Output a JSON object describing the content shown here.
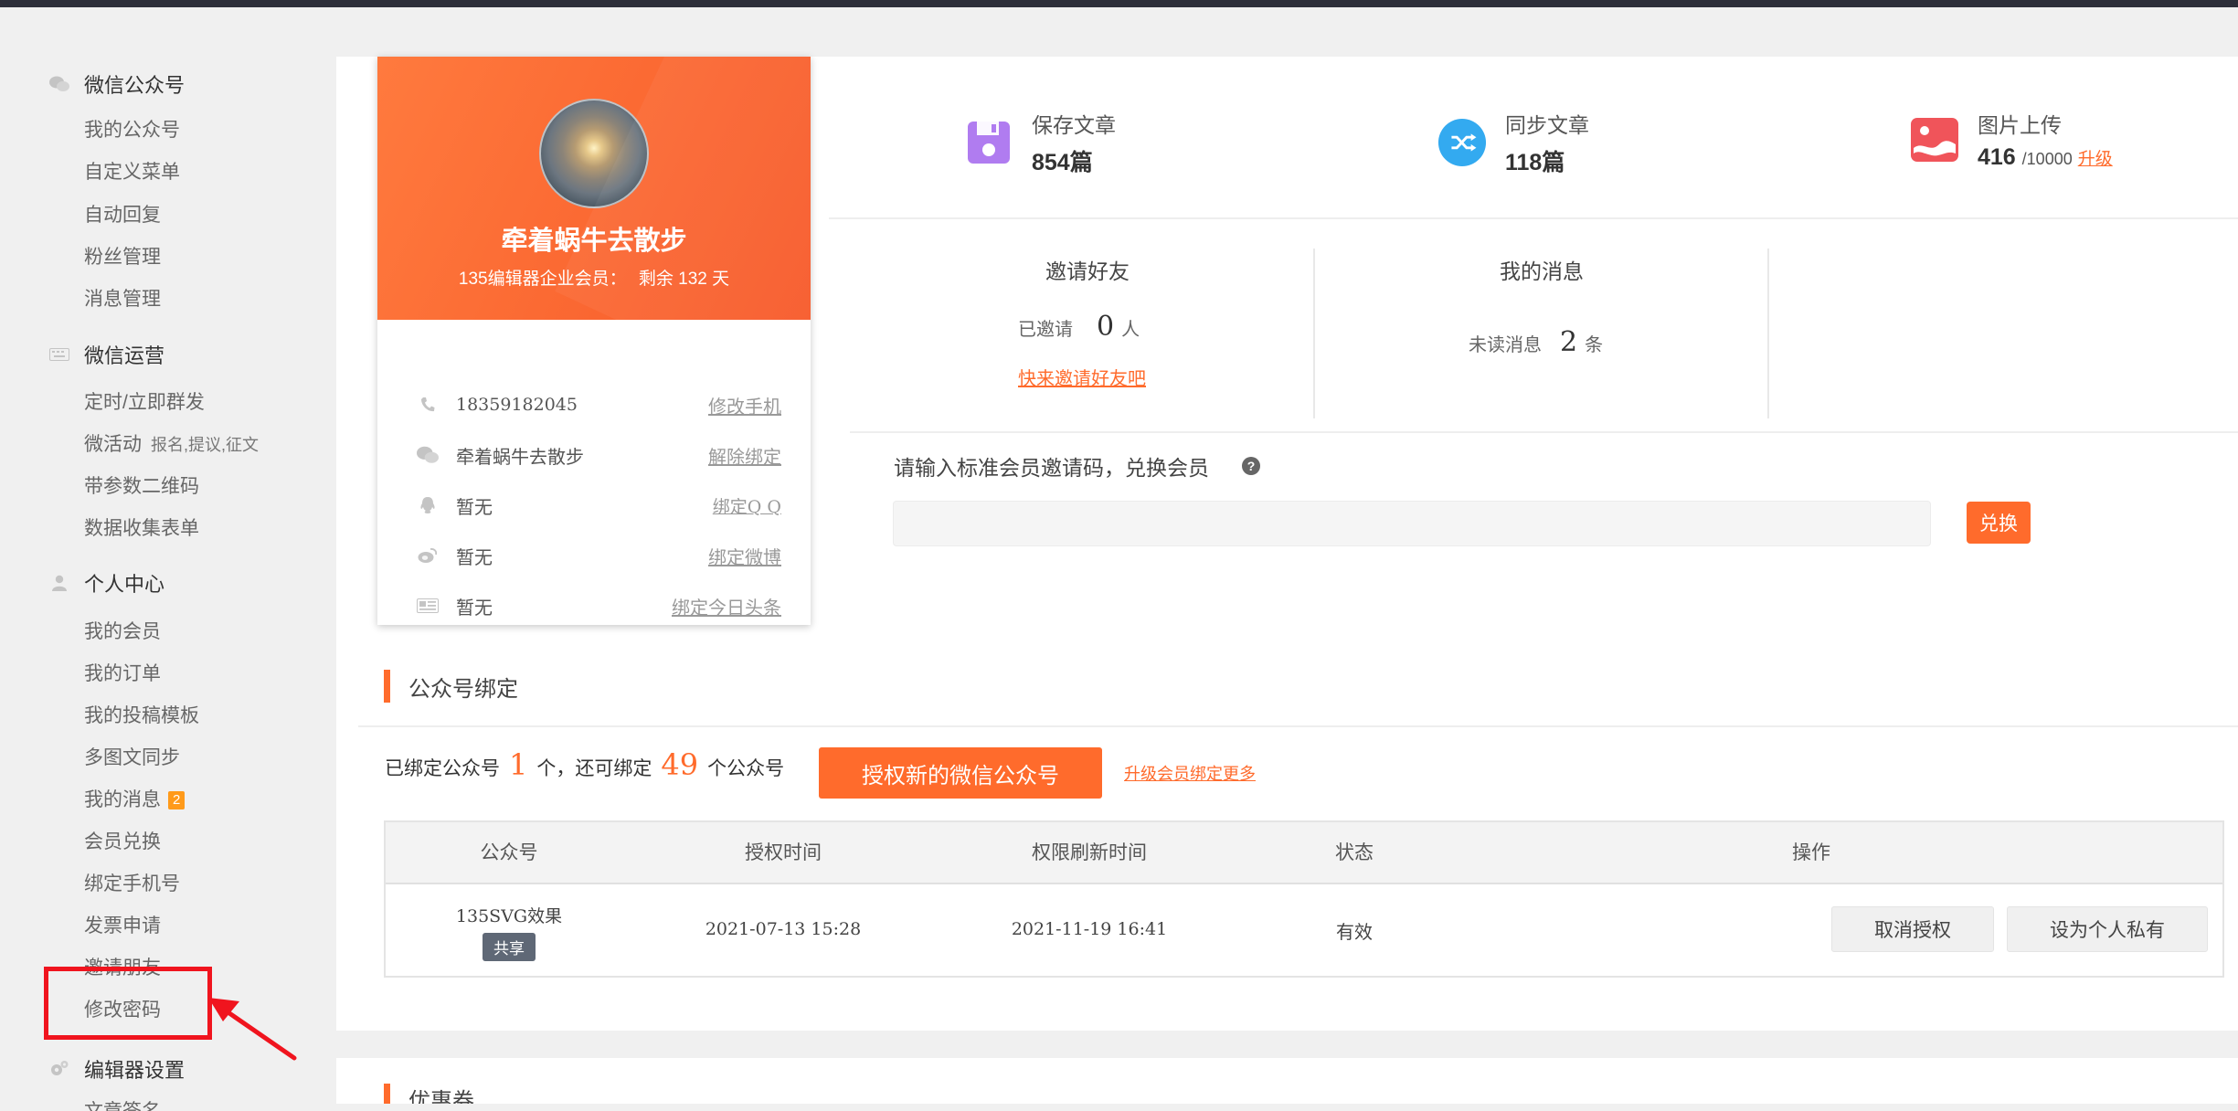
{
  "sidebar": {
    "sections": [
      {
        "icon": "wechat-icon",
        "label": "微信公众号",
        "items": [
          "我的公众号",
          "自定义菜单",
          "自动回复",
          "粉丝管理",
          "消息管理"
        ]
      },
      {
        "icon": "keyboard-icon",
        "label": "微信运营",
        "items": [
          "定时/立即群发",
          "微活动",
          "带参数二维码",
          "数据收集表单"
        ],
        "micro_note": "报名,提议,征文"
      },
      {
        "icon": "user-icon",
        "label": "个人中心",
        "items": [
          "我的会员",
          "我的订单",
          "我的投稿模板",
          "多图文同步",
          "我的消息",
          "会员兑换",
          "绑定手机号",
          "发票申请",
          "邀请朋友",
          "修改密码"
        ],
        "message_badge": "2"
      },
      {
        "icon": "gears-icon",
        "label": "编辑器设置",
        "items": [
          "文章签名"
        ]
      }
    ],
    "highlighted_item": "修改密码"
  },
  "profile": {
    "name": "牵着蜗牛去散步",
    "membership_prefix": "135编辑器企业会员：",
    "membership_days": "剩余 132 天",
    "rows": [
      {
        "icon": "phone-icon",
        "value": "18359182045",
        "action": "修改手机"
      },
      {
        "icon": "wechat-icon",
        "value": "牵着蜗牛去散步",
        "action": "解除绑定"
      },
      {
        "icon": "qq-icon",
        "value": "暂无",
        "action": "绑定Q Q"
      },
      {
        "icon": "weibo-icon",
        "value": "暂无",
        "action": "绑定微博"
      },
      {
        "icon": "toutiao-icon",
        "value": "暂无",
        "action": "绑定今日头条"
      }
    ]
  },
  "stats": {
    "saved": {
      "label": "保存文章",
      "value": "854篇",
      "color": "#b07cf0"
    },
    "synced": {
      "label": "同步文章",
      "value": "118篇",
      "color": "#33aaf0"
    },
    "images": {
      "label": "图片上传",
      "value": "416",
      "limit": "/10000",
      "upgrade": "升级",
      "color": "#f0545a"
    }
  },
  "invite": {
    "title": "邀请好友",
    "invited_label": "已邀请",
    "invited_count": "0",
    "unit": "人",
    "link": "快来邀请好友吧"
  },
  "messages": {
    "title": "我的消息",
    "unread_label": "未读消息",
    "unread_count": "2",
    "unit": "条"
  },
  "redeem": {
    "label": "请输入标准会员邀请码，兑换会员",
    "help": "?",
    "placeholder": "",
    "button": "兑换"
  },
  "binding": {
    "section_title": "公众号绑定",
    "bound_prefix": "已绑定公众号",
    "bound_count": "1",
    "bound_mid": "个，还可绑定",
    "remaining_count": "49",
    "remaining_suffix": "个公众号",
    "auth_button": "授权新的微信公众号",
    "upgrade_link": "升级会员绑定更多",
    "table": {
      "headers": [
        "公众号",
        "授权时间",
        "权限刷新时间",
        "状态",
        "操作"
      ],
      "rows": [
        {
          "account": "135SVG效果",
          "tag": "共享",
          "auth_time": "2021-07-13 15:28",
          "refresh_time": "2021-11-19 16:41",
          "status": "有效",
          "actions": [
            "取消授权",
            "设为个人私有"
          ]
        }
      ]
    }
  },
  "coupon": {
    "section_title": "优惠券"
  },
  "colors": {
    "accent": "#ff6b2c",
    "highlight_red": "#f0141e",
    "topbar": "#2d2f3a"
  }
}
